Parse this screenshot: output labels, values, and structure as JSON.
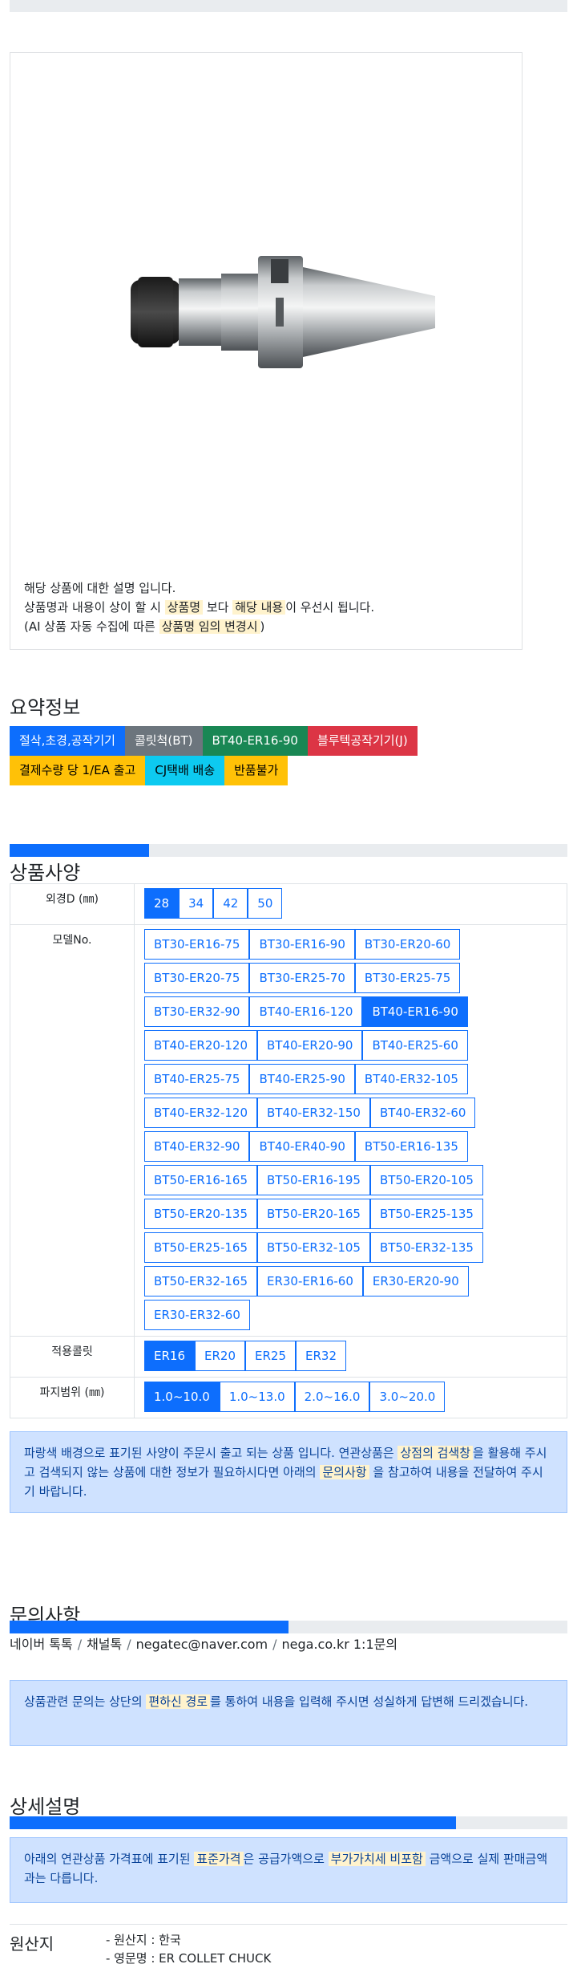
{
  "product": {
    "image_alt": "BT40-ER16-90 collet chuck",
    "desc_line1": "해당 상품에 대한 설명 입니다.",
    "desc_line2_pre": "상품명과 내용이 상이 할 시",
    "desc_line2_hl1": "상품명",
    "desc_line2_mid": "보다",
    "desc_line2_hl2": "해당 내용",
    "desc_line2_post": "이 우선시 됩니다.",
    "desc_line3_pre": "(AI 상품 자동 수집에 따른",
    "desc_line3_hl": "상품명 임의 변경시",
    "desc_line3_post": ")"
  },
  "summary": {
    "title": "요약정보",
    "badges": [
      {
        "label": "절삭,초경,공작기기",
        "color": "#0d6efd",
        "text": "#ffffff"
      },
      {
        "label": "콜릿척(BT)",
        "color": "#6c757d",
        "text": "#ffffff"
      },
      {
        "label": "BT40-ER16-90",
        "color": "#198754",
        "text": "#ffffff"
      },
      {
        "label": "블루텍공작기기(J)",
        "color": "#dc3545",
        "text": "#ffffff"
      },
      {
        "label": "결제수량 당 1/EA 출고",
        "color": "#ffc107",
        "text": "#000000"
      },
      {
        "label": "CJ택배 배송",
        "color": "#0dcaf0",
        "text": "#000000"
      },
      {
        "label": "반품불가",
        "color": "#ffc107",
        "text": "#000000"
      }
    ]
  },
  "spec": {
    "title": "상품사양",
    "progress": 0.25,
    "rows": [
      {
        "label": "외경D (㎜)",
        "options": [
          "28",
          "34",
          "42",
          "50"
        ],
        "selected": "28"
      },
      {
        "label": "모델No.",
        "options": [
          "BT30-ER16-75",
          "BT30-ER16-90",
          "BT30-ER20-60",
          "BT30-ER20-75",
          "BT30-ER25-70",
          "BT30-ER25-75",
          "BT30-ER32-90",
          "BT40-ER16-120",
          "BT40-ER16-90",
          "BT40-ER20-120",
          "BT40-ER20-90",
          "BT40-ER25-60",
          "BT40-ER25-75",
          "BT40-ER25-90",
          "BT40-ER32-105",
          "BT40-ER32-120",
          "BT40-ER32-150",
          "BT40-ER32-60",
          "BT40-ER32-90",
          "BT40-ER40-90",
          "BT50-ER16-135",
          "BT50-ER16-165",
          "BT50-ER16-195",
          "BT50-ER20-105",
          "BT50-ER20-135",
          "BT50-ER20-165",
          "BT50-ER25-135",
          "BT50-ER25-165",
          "BT50-ER32-105",
          "BT50-ER32-135",
          "BT50-ER32-165",
          "ER30-ER16-60",
          "ER30-ER20-90",
          "ER30-ER32-60"
        ],
        "selected": "BT40-ER16-90"
      },
      {
        "label": "적용콜릿",
        "options": [
          "ER16",
          "ER20",
          "ER25",
          "ER32"
        ],
        "selected": "ER16"
      },
      {
        "label": "파지범위 (㎜)",
        "options": [
          "1.0~10.0",
          "1.0~13.0",
          "2.0~16.0",
          "3.0~20.0"
        ],
        "selected": "1.0~10.0"
      }
    ],
    "notice_pre": "파랑색 배경으로 표기된 사양이 주문시 출고 되는 상품 입니다. 연관상품은",
    "notice_hl1": "상점의 검색창",
    "notice_mid": "을 활용해 주시고 검색되지 않는 상품에 대한 정보가 필요하시다면 아래의",
    "notice_hl2": "문의사항",
    "notice_post": "을 참고하여 내용을 전달하여 주시기 바랍니다."
  },
  "inquiry": {
    "title": "문의사항",
    "progress": 0.5,
    "links": [
      "네이버 톡톡",
      "채널톡",
      "negatec@naver.com",
      "nega.co.kr 1:1문의"
    ],
    "separator": "/",
    "notice_pre": "상품관련 문의는 상단의",
    "notice_hl": "편하신 경로",
    "notice_post": "를 통하여 내용을 입력해 주시면 성실하게 답변해 드리겠습니다."
  },
  "detail": {
    "title": "상세설명",
    "progress": 0.8,
    "notice_pre": "아래의 연관상품 가격표에 표기된",
    "notice_hl1": "표준가격",
    "notice_mid": "은 공급가액으로",
    "notice_hl2": "부가가치세 비포함",
    "notice_post": "금액으로 실제 판매금액과는 다릅니다."
  },
  "origin": {
    "title": "원산지",
    "items": [
      "- 원산지 : 한국",
      "- 영문명 : ER COLLET CHUCK"
    ]
  }
}
